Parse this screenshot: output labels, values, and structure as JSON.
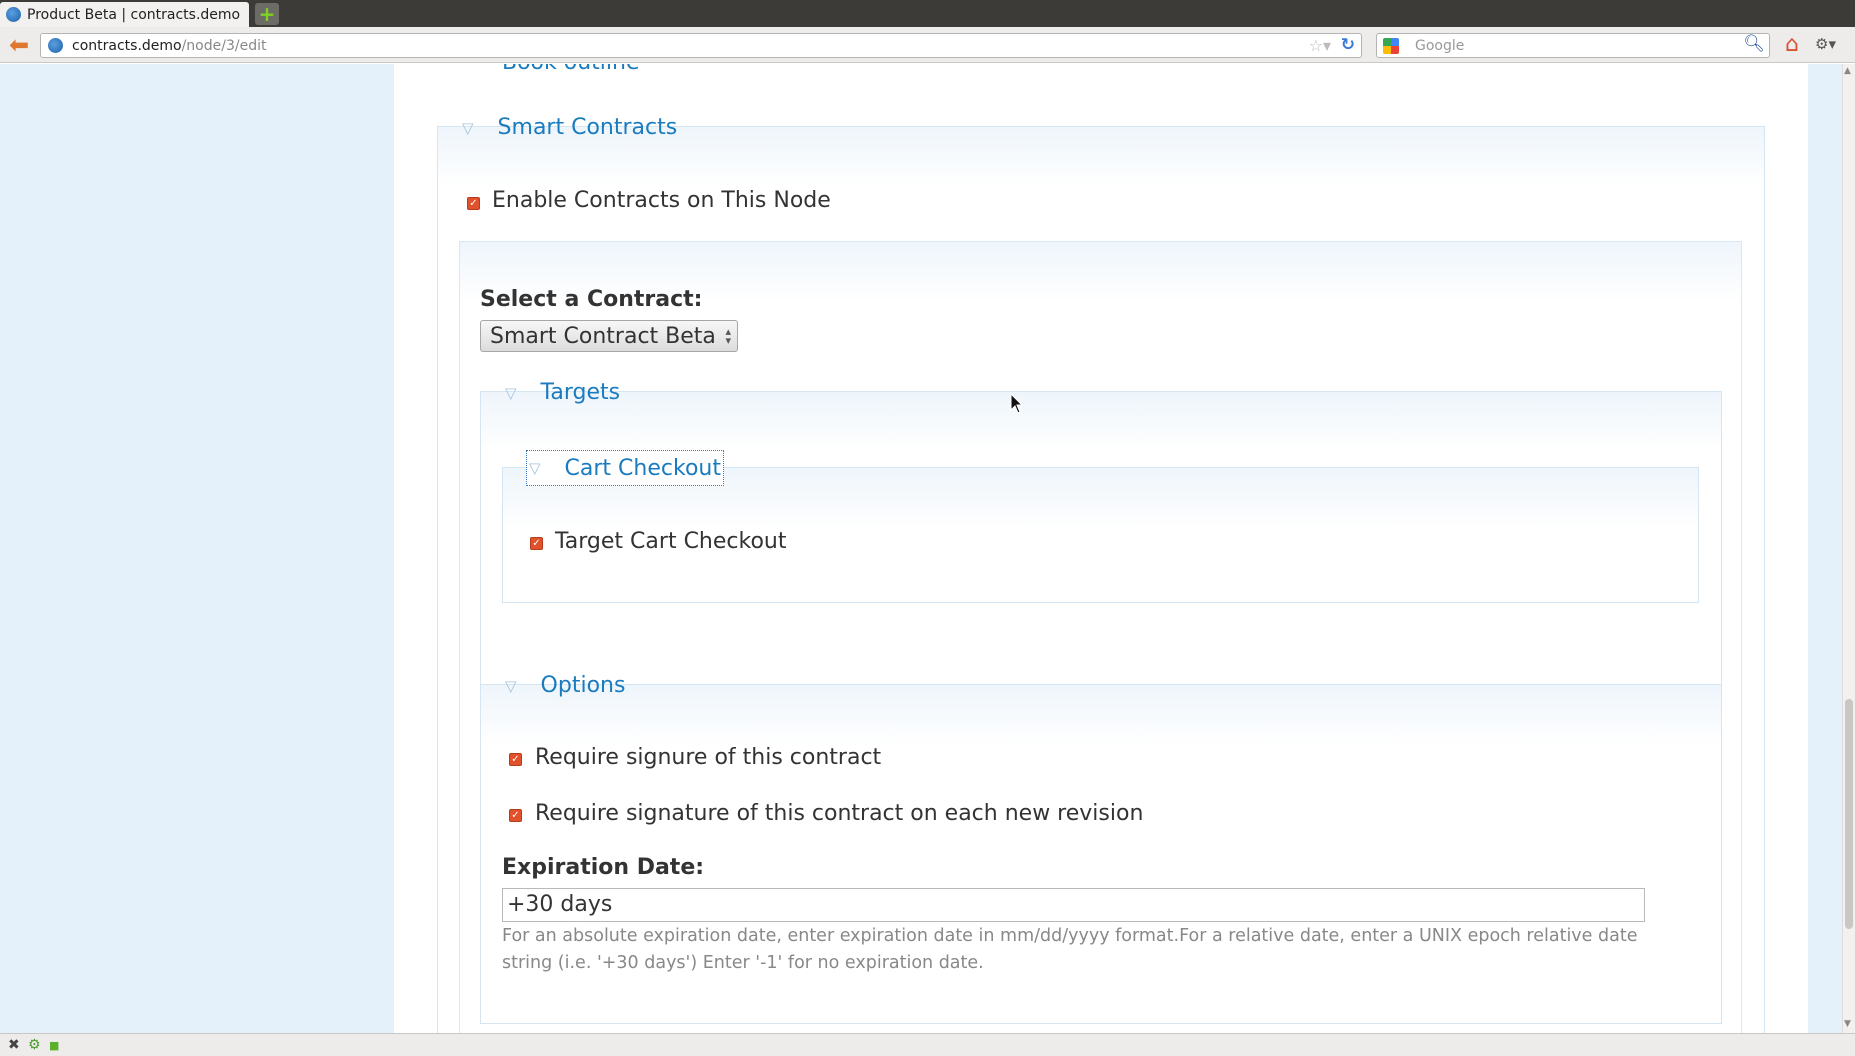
{
  "browser": {
    "tab_title": "Product Beta | contracts.demo",
    "new_tab_label": "+",
    "url_host": "contracts.demo",
    "url_path": "/node/3/edit",
    "search_placeholder": "Google"
  },
  "page": {
    "cut_off_legend": "Book outline",
    "smart_contracts": {
      "legend": "Smart Contracts",
      "enable_label": "Enable Contracts on This Node",
      "enable_checked": true,
      "select_label": "Select a Contract:",
      "selected_contract": "Smart Contract Beta",
      "targets": {
        "legend": "Targets",
        "cart_checkout": {
          "legend": "Cart Checkout",
          "target_label": "Target Cart Checkout",
          "target_checked": true
        }
      },
      "options": {
        "legend": "Options",
        "require_signature_label": "Require signure of this contract",
        "require_signature_checked": true,
        "require_revision_label": "Require signature of this contract on each new revision",
        "require_revision_checked": true,
        "expiration_label": "Expiration Date:",
        "expiration_value": "+30 days",
        "expiration_description": "For an absolute expiration date, enter expiration date in mm/dd/yyyy format.For a relative date, enter a UNIX epoch relative date string (i.e. '+30 days') Enter '-1' for no expiration date."
      }
    }
  },
  "icons": {
    "collapse": "triangle-down-icon",
    "checkbox": "checkbox-checked-icon"
  },
  "colors": {
    "link": "#1a7bbf",
    "checkbox": "#e0512c",
    "sidebar": "#e4f1fa"
  }
}
